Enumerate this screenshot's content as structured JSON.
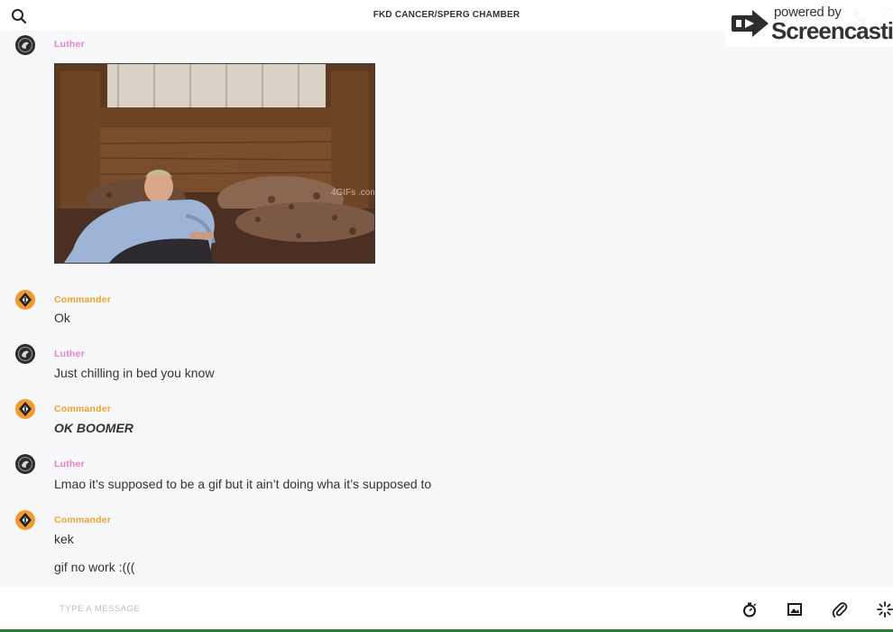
{
  "header": {
    "title": "FKD CANCER/SPERG CHAMBER",
    "search_icon": "search-icon",
    "call_icon": "phone-icon",
    "info_icon": "info-icon"
  },
  "watermark": {
    "line1": "powered by",
    "line2": "Screencastify"
  },
  "colors": {
    "luther": "#e77fc8",
    "commander": "#f0a130",
    "background": "#f8f8fa",
    "text": "#333333"
  },
  "messages": [
    {
      "sender": "Luther",
      "type": "gif",
      "gif_watermark": "4GIFs\n.com"
    },
    {
      "sender": "Commander",
      "text": "Ok"
    },
    {
      "sender": "Luther",
      "text": "Just chilling in bed you know"
    },
    {
      "sender": "Commander",
      "text": "OK BOOMER"
    },
    {
      "sender": "Luther",
      "text": "Lmao it’s supposed to be a gif but it ain’t doing wha it’s supposed to"
    },
    {
      "sender": "Commander",
      "text": "kek"
    },
    {
      "sender": "Commander",
      "text": "gif no work :((("
    }
  ],
  "composer": {
    "placeholder": "TYPE A MESSAGE",
    "value": "",
    "tools": [
      "timer-icon",
      "image-icon",
      "paperclip-icon",
      "sparkle-icon"
    ]
  }
}
